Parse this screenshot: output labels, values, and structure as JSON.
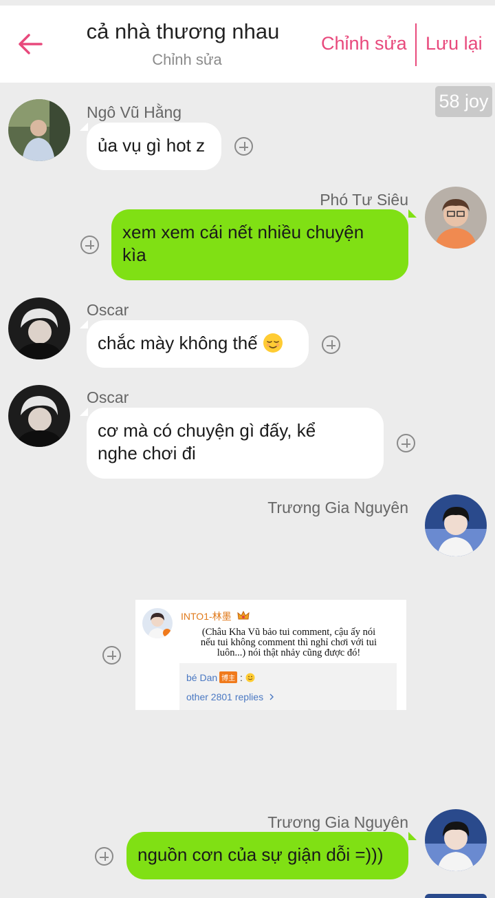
{
  "header": {
    "title": "cả nhà thương nhau",
    "subtitle": "Chỉnh sửa",
    "edit_label": "Chỉnh sửa",
    "save_label": "Lưu lại",
    "accent_color": "#e8497c"
  },
  "coin_badge": "58 joy",
  "messages": [
    {
      "side": "left",
      "sender": "Ngô Vũ Hằng",
      "text": "ủa vụ gì hot z",
      "bubble_color": "#ffffff"
    },
    {
      "side": "right",
      "sender": "Phó Tư Siêu",
      "text_line1": "xem xem cái nết nhiều chuyện",
      "text_line2": "kìa",
      "bubble_color": "#80e014"
    },
    {
      "side": "left",
      "sender": "Oscar",
      "text": "chắc mày không thế",
      "emoji": "relieved-face"
    },
    {
      "side": "left",
      "sender": "Oscar",
      "text_line1": "cơ mà có chuyện gì đấy, kể",
      "text_line2": "nghe chơi đi"
    },
    {
      "side": "right",
      "sender": "Trương Gia Nguyên",
      "image": {
        "user": "INTO1-林墨",
        "text_line1": "(Châu Kha Vũ bảo tui comment, cậu ấy nói",
        "text_line2": "nếu tui không comment thì nghỉ chơi với tui",
        "text_line3": "luôn...) nói thật nhảy cũng được đó!",
        "reply_user": "bé Dan",
        "reply_tag": "博主",
        "reply_colon": " : ",
        "more_replies": "other 2801 replies"
      }
    },
    {
      "side": "right",
      "sender": "Trương Gia Nguyên",
      "text": "nguồn cơn của sự giận dỗi =)))"
    }
  ]
}
